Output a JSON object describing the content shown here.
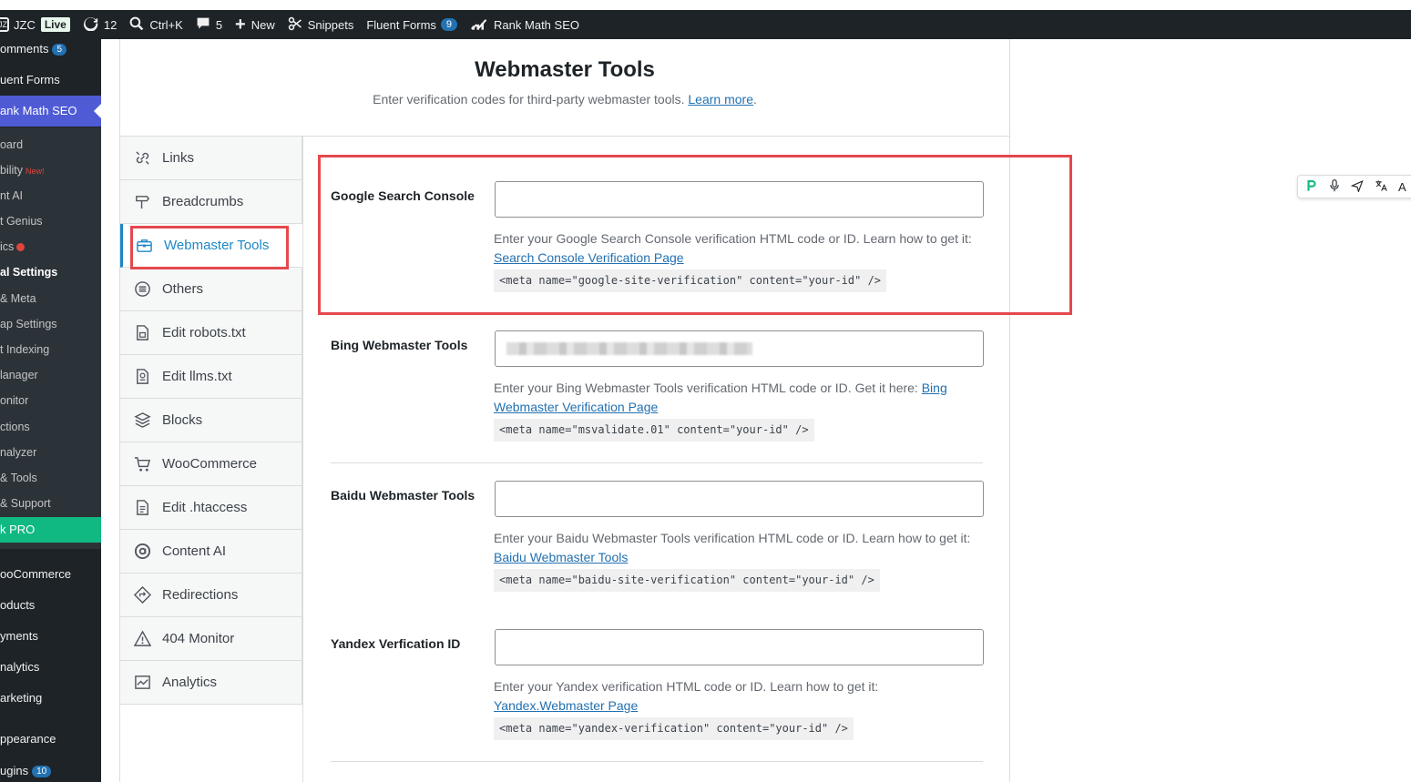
{
  "adminbar": {
    "site_name": "JZC",
    "live_label": "Live",
    "updates_count": "12",
    "search_shortcut": "Ctrl+K",
    "comments_count": "5",
    "new_label": "New",
    "snippets_label": "Snippets",
    "fluent_forms_label": "Fluent Forms",
    "fluent_forms_count": "9",
    "rank_math_label": "Rank Math SEO"
  },
  "adminmenu": {
    "comments": "omments",
    "comments_count": "5",
    "fluent_forms": "uent Forms",
    "rank_math": "ank Math SEO",
    "sub": [
      "oard",
      "bility",
      "nt AI",
      "t Genius",
      "ics",
      "al Settings",
      "& Meta",
      "ap Settings",
      "t Indexing",
      "lanager",
      "onitor",
      "ctions",
      "nalyzer",
      "& Tools",
      "& Support"
    ],
    "sub_new": "New!",
    "pro": "k PRO",
    "woocommerce": "ooCommerce",
    "products": "oducts",
    "payments": "yments",
    "analytics": "nalytics",
    "marketing": "arketing",
    "appearance": "ppearance",
    "plugins": "ugins",
    "plugins_count": "10"
  },
  "header": {
    "title": "Webmaster Tools",
    "description": "Enter verification codes for third-party webmaster tools.",
    "learn_more": "Learn more",
    "period": "."
  },
  "tabs": [
    {
      "label": "Links",
      "icon": "links-icon"
    },
    {
      "label": "Breadcrumbs",
      "icon": "signpost-icon"
    },
    {
      "label": "Webmaster Tools",
      "icon": "toolbox-icon"
    },
    {
      "label": "Others",
      "icon": "list-circle-icon"
    },
    {
      "label": "Edit robots.txt",
      "icon": "robots-file-icon"
    },
    {
      "label": "Edit llms.txt",
      "icon": "llms-file-icon"
    },
    {
      "label": "Blocks",
      "icon": "blocks-icon"
    },
    {
      "label": "WooCommerce",
      "icon": "cart-icon"
    },
    {
      "label": "Edit .htaccess",
      "icon": "htaccess-file-icon"
    },
    {
      "label": "Content AI",
      "icon": "content-ai-icon"
    },
    {
      "label": "Redirections",
      "icon": "redirections-icon"
    },
    {
      "label": "404 Monitor",
      "icon": "warning-icon"
    },
    {
      "label": "Analytics",
      "icon": "analytics-icon"
    }
  ],
  "fields": {
    "google": {
      "label": "Google Search Console",
      "value": "",
      "desc": "Enter your Google Search Console verification HTML code or ID. Learn how to get it:",
      "link": "Search Console Verification Page",
      "code": "<meta name=\"google-site-verification\" content=\"your-id\" />"
    },
    "bing": {
      "label": "Bing Webmaster Tools",
      "value": "",
      "desc": "Enter your Bing Webmaster Tools verification HTML code or ID. Get it here:",
      "link": "Bing Webmaster Verification Page",
      "code": "<meta name=\"msvalidate.01\" content=\"your-id\" />"
    },
    "baidu": {
      "label": "Baidu Webmaster Tools",
      "value": "",
      "desc": "Enter your Baidu Webmaster Tools verification HTML code or ID. Learn how to get it:",
      "link": "Baidu Webmaster Tools",
      "code": "<meta name=\"baidu-site-verification\" content=\"your-id\" />"
    },
    "yandex": {
      "label": "Yandex Verfication ID",
      "value": "",
      "desc": "Enter your Yandex verification HTML code or ID. Learn how to get it:",
      "link": "Yandex.Webmaster Page",
      "code": "<meta name=\"yandex-verification\" content=\"your-id\" />"
    }
  },
  "float_tools": {
    "last_label": "A"
  },
  "colors": {
    "accent": "#1e87c7",
    "highlight": "#e5484d",
    "rank_math": "#4f5bd5",
    "pro": "#10b981"
  }
}
